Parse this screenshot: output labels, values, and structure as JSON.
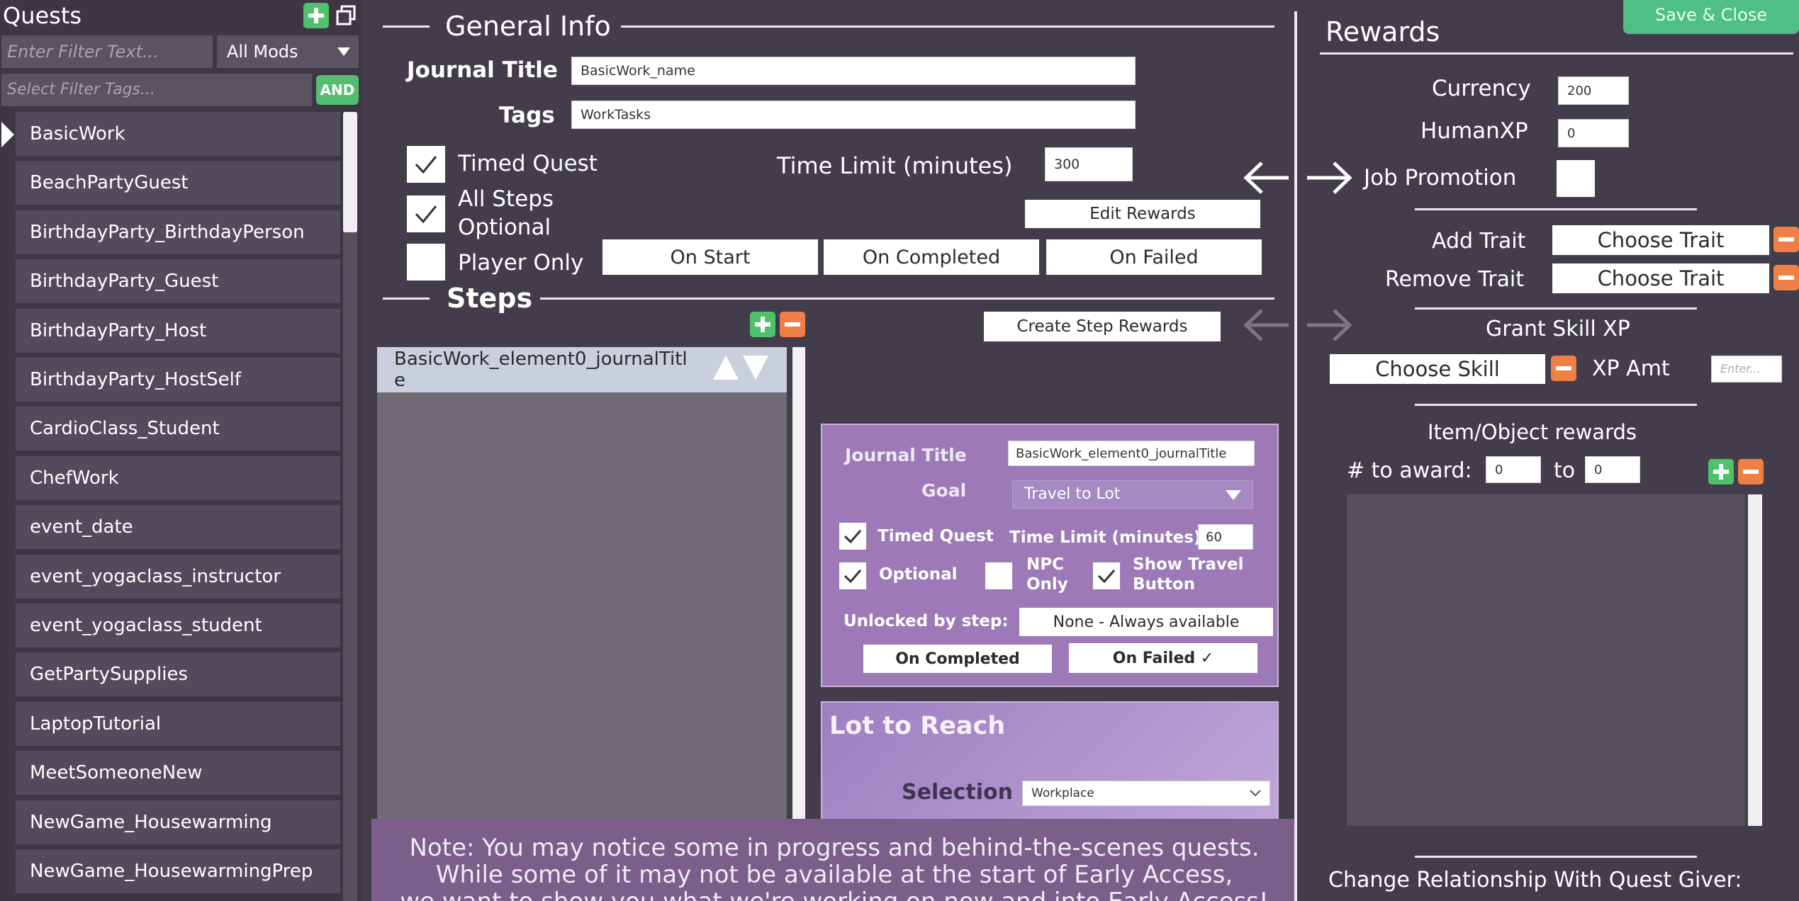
{
  "quests_panel": {
    "title": "Quests",
    "filter_text_placeholder": "Enter Filter Text...",
    "mods_select": "All Mods",
    "filter_tags_placeholder": "Select Filter Tags...",
    "and_button": "AND",
    "items": [
      {
        "label": "BasicWork"
      },
      {
        "label": "BeachPartyGuest"
      },
      {
        "label": "BirthdayParty_BirthdayPerson"
      },
      {
        "label": "BirthdayParty_Guest"
      },
      {
        "label": "BirthdayParty_Host"
      },
      {
        "label": "BirthdayParty_HostSelf"
      },
      {
        "label": "CardioClass_Student"
      },
      {
        "label": "ChefWork"
      },
      {
        "label": "event_date"
      },
      {
        "label": "event_yogaclass_instructor"
      },
      {
        "label": "event_yogaclass_student"
      },
      {
        "label": "GetPartySupplies"
      },
      {
        "label": "LaptopTutorial"
      },
      {
        "label": "MeetSomeoneNew"
      },
      {
        "label": "NewGame_Housewarming"
      },
      {
        "label": "NewGame_HousewarmingPrep"
      }
    ]
  },
  "general_info": {
    "heading": "General Info",
    "journal_title_label": "Journal Title",
    "journal_title_value": "BasicWork_name",
    "tags_label": "Tags",
    "tags_value": "WorkTasks",
    "timed_quest_label": "Timed Quest",
    "all_steps_optional_label_1": "All Steps",
    "all_steps_optional_label_2": "Optional",
    "player_only_label": "Player Only",
    "time_limit_label": "Time Limit (minutes)",
    "time_limit_value": "300",
    "edit_rewards_button": "Edit Rewards",
    "on_start_button": "On Start",
    "on_completed_button": "On Completed",
    "on_failed_button": "On Failed"
  },
  "steps": {
    "heading": "Steps",
    "create_step_rewards_button": "Create Step Rewards",
    "selected_step_line1": "BasicWork_element0_journalTitl",
    "selected_step_line2": "e",
    "detail": {
      "journal_title_label": "Journal Title",
      "journal_title_value": "BasicWork_element0_journalTitle",
      "goal_label": "Goal",
      "goal_value": "Travel to Lot",
      "timed_quest_label": "Timed Quest",
      "time_limit_label": "Time Limit (minutes)",
      "time_limit_value": "60",
      "optional_label": "Optional",
      "npc_only_label_1": "NPC",
      "npc_only_label_2": "Only",
      "show_travel_label_1": "Show Travel",
      "show_travel_label_2": "Button",
      "unlocked_by_label": "Unlocked by step:",
      "unlocked_by_value": "None - Always available",
      "on_completed_button": "On Completed",
      "on_failed_button": "On Failed ✓"
    },
    "lot": {
      "heading": "Lot to Reach",
      "selection_label": "Selection",
      "selection_value": "Workplace"
    }
  },
  "rewards": {
    "heading": "Rewards",
    "save_close_button": "Save & Close",
    "currency_label": "Currency",
    "currency_value": "200",
    "humanxp_label": "HumanXP",
    "humanxp_value": "0",
    "job_promotion_label": "Job Promotion",
    "add_trait_label": "Add Trait",
    "add_trait_button": "Choose Trait",
    "remove_trait_label": "Remove Trait",
    "remove_trait_button": "Choose Trait",
    "grant_skill_heading": "Grant Skill XP",
    "choose_skill_button": "Choose Skill",
    "xp_amt_label": "XP Amt",
    "xp_amt_placeholder": "Enter...",
    "item_rewards_heading": "Item/Object rewards",
    "to_award_label": "# to award:",
    "to_award_from": "0",
    "to_label": "to",
    "to_award_to": "0",
    "relationship_heading": "Change Relationship With Quest Giver:"
  },
  "note": {
    "line1": "Note: You may notice some in progress and behind-the-scenes quests.",
    "line2": "While some of it may not be available at the start of Early Access,",
    "line3": "we want to show you what we're working on now and into Early Access!"
  },
  "colors": {
    "background": "#433d4b",
    "accent_green": "#4fc16a",
    "accent_orange": "#f07f45",
    "step_panel": "#9d79b8"
  }
}
